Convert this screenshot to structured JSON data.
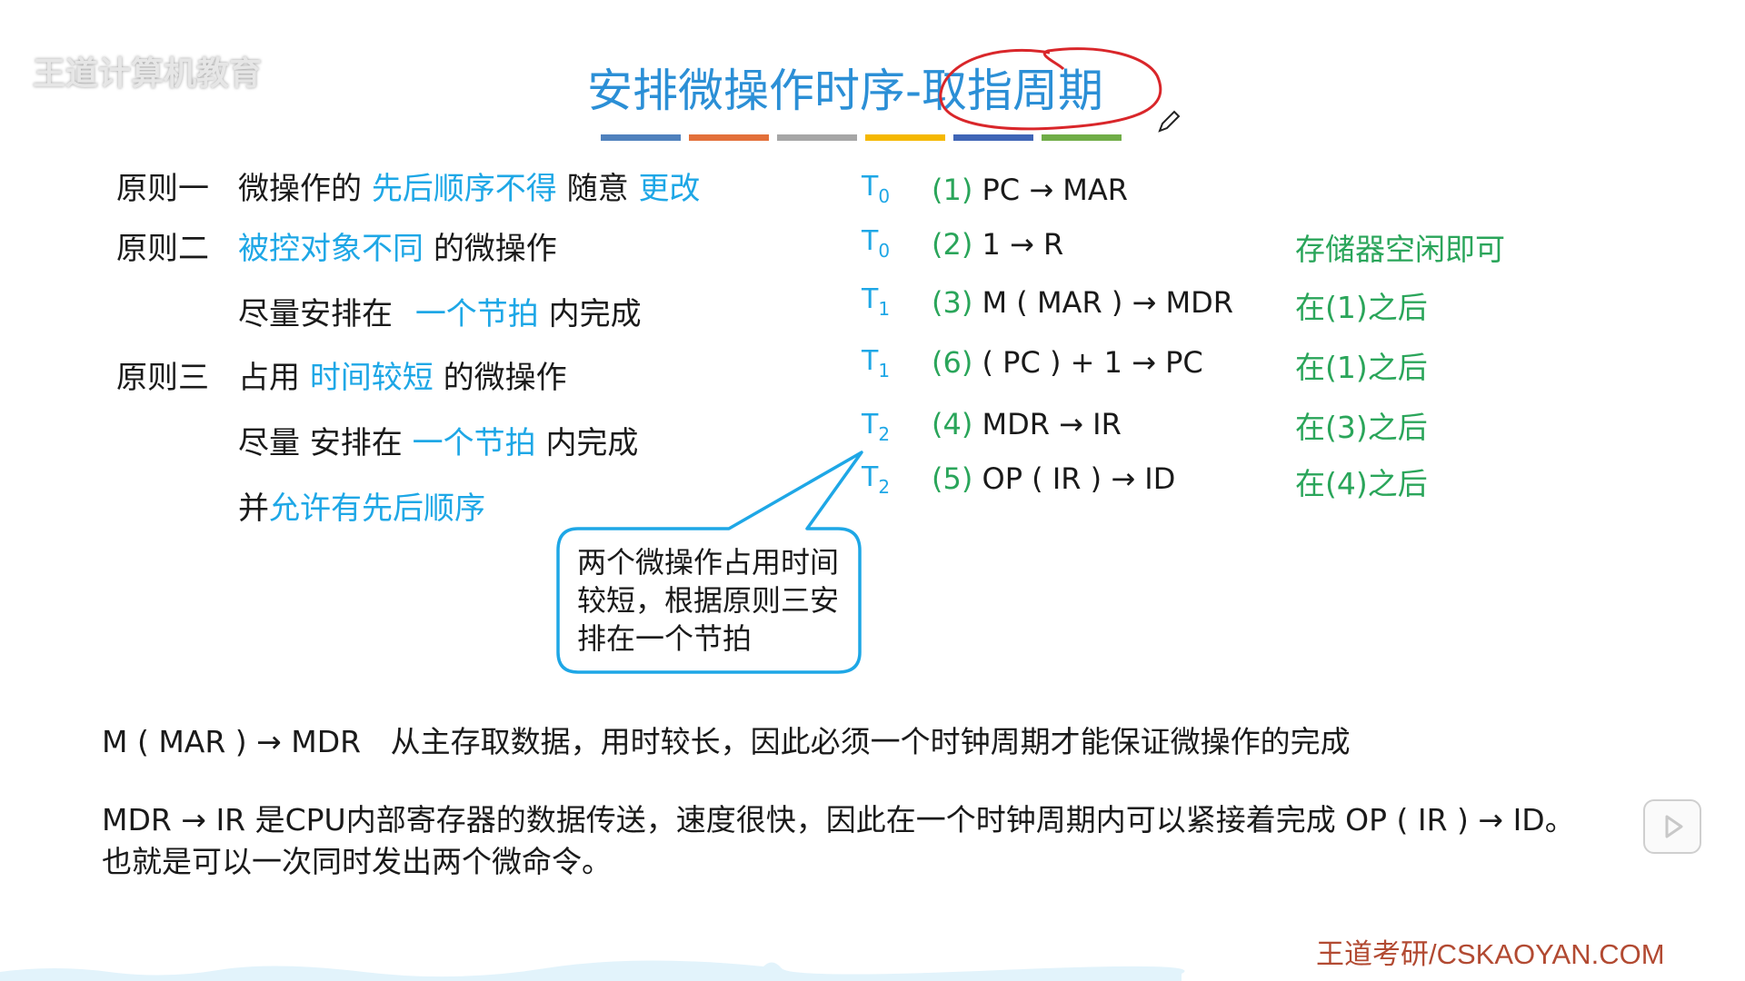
{
  "watermark": "王道计算机教育",
  "title": "安排微操作时序-取指周期",
  "title_bar_colors": [
    "#4f81bd",
    "#e3703a",
    "#a6a6a6",
    "#f5b800",
    "#3f65b6",
    "#70ad47"
  ],
  "principles": {
    "p1": {
      "label": "原则一",
      "a": "微操作的",
      "b": "先后顺序不得",
      "c": "随意",
      "d": "更改"
    },
    "p2": {
      "label": "原则二",
      "a": "被控对象不同",
      "b": "的微操作",
      "c": "尽量安排在",
      "d": "一个节拍",
      "e": "内完成"
    },
    "p3": {
      "label": "原则三",
      "a": "占用",
      "b": "时间较短",
      "c": "的微操作",
      "d": "尽量 安排在",
      "e": "一个节拍",
      "f": "内完成",
      "g": "并",
      "h": "允许有先后顺序"
    }
  },
  "steps": [
    {
      "t": "T",
      "sub": "0",
      "num": "(1)",
      "op": "PC → MAR",
      "note": ""
    },
    {
      "t": "T",
      "sub": "0",
      "num": "(2)",
      "op": "1 → R",
      "note": "存储器空闲即可"
    },
    {
      "t": "T",
      "sub": "1",
      "num": "(3)",
      "op": "M ( MAR ) → MDR",
      "note": "在(1)之后"
    },
    {
      "t": "T",
      "sub": "1",
      "num": "(6)",
      "op": "( PC ) + 1 → PC",
      "note": "在(1)之后"
    },
    {
      "t": "T",
      "sub": "2",
      "num": "(4)",
      "op": "MDR → IR",
      "note": "在(3)之后"
    },
    {
      "t": "T",
      "sub": "2",
      "num": "(5)",
      "op": "OP ( IR ) → ID",
      "note": "在(4)之后"
    }
  ],
  "callout": "两个微操作占用时间较短，根据原则三安排在一个节拍",
  "bottom": {
    "line1_left": "M ( MAR ) → MDR",
    "line1_right": "从主存取数据，用时较长，因此必须一个时钟周期才能保证微操作的完成",
    "line2": "MDR → IR  是CPU内部寄存器的数据传送，速度很快，因此在一个时钟周期内可以紧接着完成 OP ( IR ) → ID。",
    "line3": "也就是可以一次同时发出两个微命令。"
  },
  "footer": "王道考研/CSKAOYAN.COM",
  "colors": {
    "blue": "#1ea7e6",
    "green": "#2aa55a",
    "title": "#2b8fd6",
    "annotation_red": "#d9262a"
  }
}
